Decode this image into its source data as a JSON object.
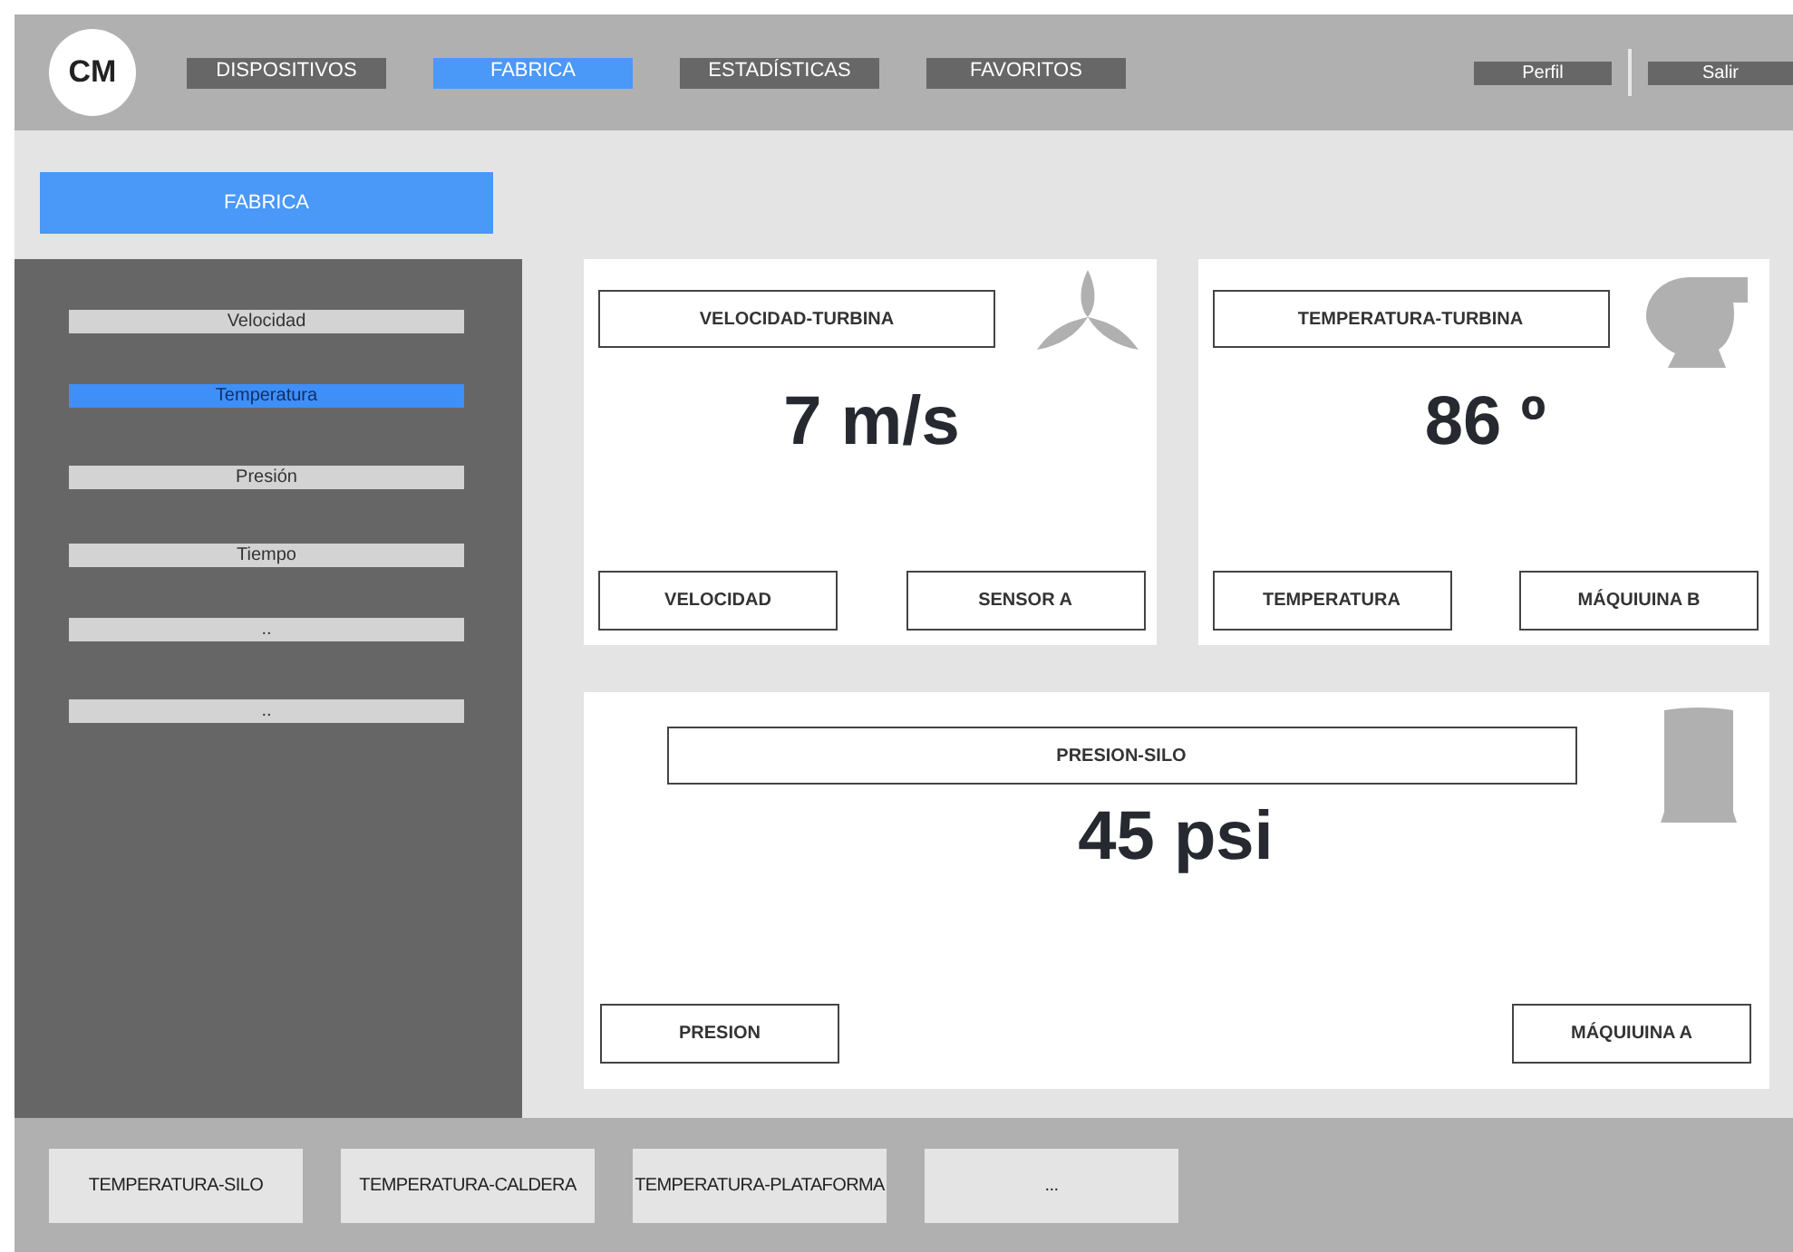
{
  "logo": "CM",
  "nav": [
    {
      "label": "DISPOSITIVOS",
      "selected": false
    },
    {
      "label": "FABRICA",
      "selected": true
    },
    {
      "label": "ESTADÍSTICAS",
      "selected": false
    },
    {
      "label": "FAVORITOS",
      "selected": false
    }
  ],
  "user_menu": [
    "Perfil",
    "Salir"
  ],
  "section_button": "FABRICA",
  "sidebar": {
    "items": [
      {
        "label": "Velocidad",
        "selected": false
      },
      {
        "label": "Temperatura",
        "selected": true
      },
      {
        "label": "Presión",
        "selected": false
      },
      {
        "label": "Tiempo",
        "selected": false
      },
      {
        "label": "..",
        "selected": false
      },
      {
        "label": "..",
        "selected": false
      }
    ]
  },
  "top_cards": [
    {
      "title": "VELOCIDAD-TURBINA",
      "value": "7 m/s",
      "tags": [
        "VELOCIDAD",
        "SENSOR A"
      ]
    },
    {
      "title": "TEMPERATURA-TURBINA",
      "value": "86 º",
      "tags": [
        "TEMPERATURA",
        "MÁQUIUINA B"
      ]
    }
  ],
  "bottom_card": {
    "title": "PRESION-SILO",
    "value": "45 psi",
    "tags": [
      "PRESION",
      "MÁQUIUINA A"
    ]
  },
  "bottom_tabs": [
    "TEMPERATURA-SILO",
    "TEMPERATURA-CALDERA",
    "TEMPERATURA-PLATAFORMA",
    "..."
  ]
}
